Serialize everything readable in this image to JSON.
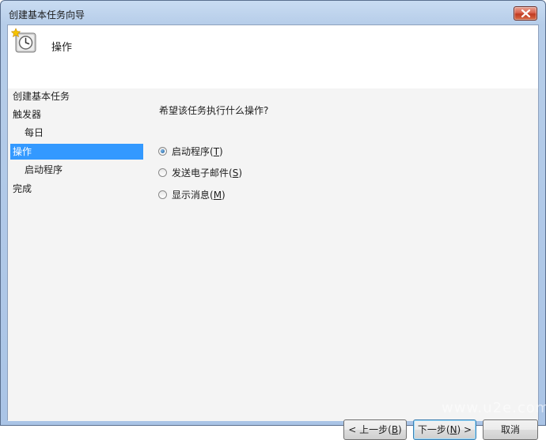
{
  "window": {
    "title": "创建基本任务向导"
  },
  "header": {
    "title": "操作",
    "icon": "task-scheduler-clock-icon"
  },
  "nav": {
    "items": [
      {
        "label": "创建基本任务",
        "level": 0,
        "selected": false
      },
      {
        "label": "触发器",
        "level": 0,
        "selected": false
      },
      {
        "label": "每日",
        "level": 1,
        "selected": false
      },
      {
        "label": "操作",
        "level": 0,
        "selected": true
      },
      {
        "label": "启动程序",
        "level": 1,
        "selected": false
      },
      {
        "label": "完成",
        "level": 0,
        "selected": false
      }
    ]
  },
  "main": {
    "prompt": "希望该任务执行什么操作?",
    "options": [
      {
        "text": "启动程序(",
        "key": "T",
        "end": ")",
        "checked": true
      },
      {
        "text": "发送电子邮件(",
        "key": "S",
        "end": ")",
        "checked": false
      },
      {
        "text": "显示消息(",
        "key": "M",
        "end": ")",
        "checked": false
      }
    ]
  },
  "buttons": {
    "back": {
      "text": "< 上一步(",
      "key": "B",
      "end": ")"
    },
    "next": {
      "text": "下一步(",
      "key": "N",
      "end": ") >"
    },
    "cancel": "取消"
  },
  "watermark": "www.u2e.com",
  "colors": {
    "selection": "#3399ff",
    "close_red": "#c03b22"
  }
}
